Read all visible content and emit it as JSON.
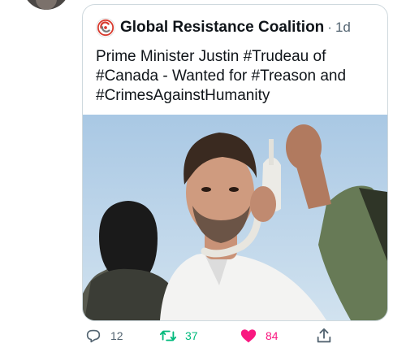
{
  "quote": {
    "author_name": "Global Resistance Coalition",
    "separator": "·",
    "timestamp": "1d",
    "text_lines": [
      "Prime Minister Justin #Trudeau of",
      "#Canada - Wanted for #Treason and",
      "#CrimesAgainstHumanity"
    ]
  },
  "actions": {
    "reply_count": "12",
    "retweet_count": "37",
    "like_count": "84",
    "retweeted": true,
    "liked": true
  },
  "icons": {
    "reply": "reply-icon",
    "retweet": "retweet-icon",
    "like": "heart-icon",
    "share": "share-icon"
  },
  "colors": {
    "text": "#0f1419",
    "muted": "#536471",
    "retweet_active": "#00ba7c",
    "like_active": "#f91880",
    "border": "#cfd9de"
  }
}
